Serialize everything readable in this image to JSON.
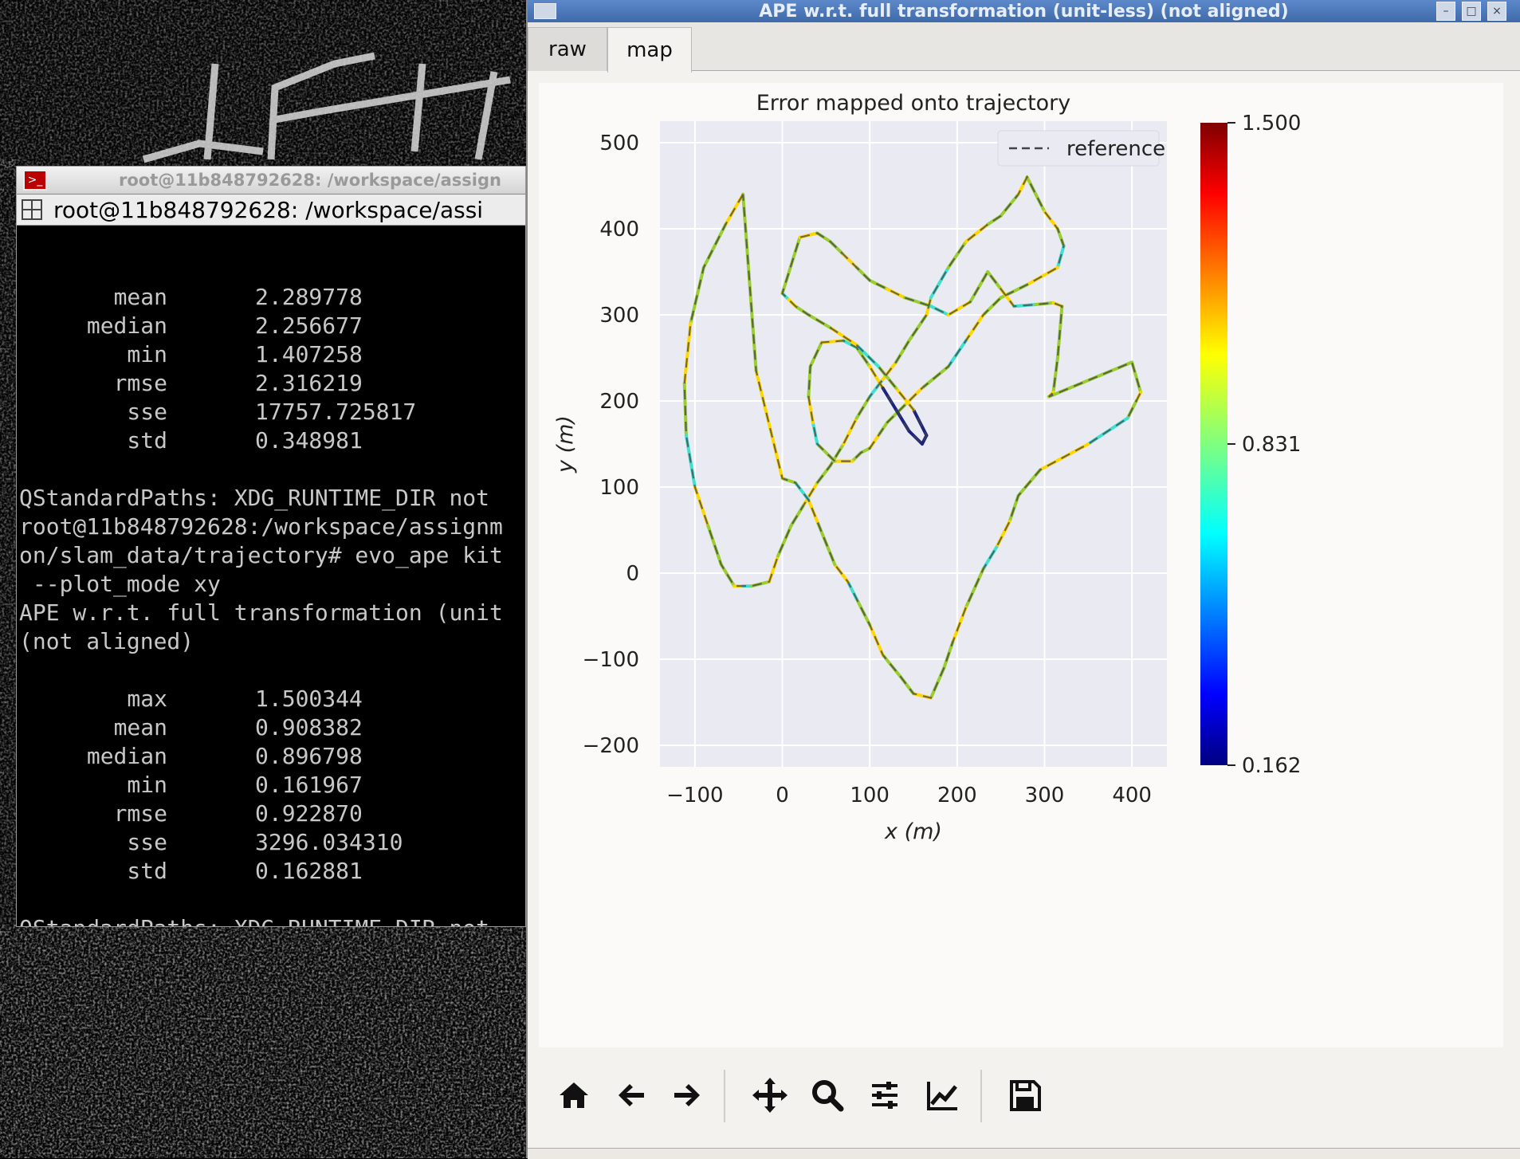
{
  "terminal": {
    "window_title": "root@11b848792628: /workspace/assign",
    "tab_title": "root@11b848792628: /workspace/assi",
    "stats1": [
      {
        "k": "mean",
        "v": "2.289778"
      },
      {
        "k": "median",
        "v": "2.256677"
      },
      {
        "k": "min",
        "v": "1.407258"
      },
      {
        "k": "rmse",
        "v": "2.316219"
      },
      {
        "k": "sse",
        "v": "17757.725817"
      },
      {
        "k": "std",
        "v": "0.348981"
      }
    ],
    "lines": [
      "QStandardPaths: XDG_RUNTIME_DIR not",
      "root@11b848792628:/workspace/assignm",
      "on/slam_data/trajectory# evo_ape kit",
      " --plot_mode xy",
      "APE w.r.t. full transformation (unit",
      "(not aligned)"
    ],
    "stats2": [
      {
        "k": "max",
        "v": "1.500344"
      },
      {
        "k": "mean",
        "v": "0.908382"
      },
      {
        "k": "median",
        "v": "0.896798"
      },
      {
        "k": "min",
        "v": "0.161967"
      },
      {
        "k": "rmse",
        "v": "0.922870"
      },
      {
        "k": "sse",
        "v": "3296.034310"
      },
      {
        "k": "std",
        "v": "0.162881"
      }
    ],
    "last_line": "QStandardPaths: XDG_RUNTIME_DIR not"
  },
  "plot_window": {
    "title": "APE w.r.t. full transformation (unit-less) (not aligned)",
    "tabs": [
      "raw",
      "map"
    ],
    "active_tab": "map",
    "toolbar_icons": [
      "home-icon",
      "back-arrow-icon",
      "forward-arrow-icon",
      "pan-icon",
      "zoom-icon",
      "configure-subplots-icon",
      "edit-axis-icon",
      "save-icon"
    ]
  },
  "chart_data": {
    "type": "line",
    "title": "Error mapped onto trajectory",
    "xlabel": "x (m)",
    "ylabel": "y (m)",
    "xlim": [
      -140,
      440
    ],
    "ylim": [
      -225,
      525
    ],
    "xticks": [
      -100,
      0,
      100,
      200,
      300,
      400
    ],
    "yticks": [
      -200,
      -100,
      0,
      100,
      200,
      300,
      400,
      500
    ],
    "xtick_labels": [
      "−100",
      "0",
      "100",
      "200",
      "300",
      "400"
    ],
    "ytick_labels": [
      "−200",
      "−100",
      "0",
      "100",
      "200",
      "300",
      "400",
      "500"
    ],
    "grid": true,
    "legend": {
      "position": "top-right",
      "entries": [
        "reference"
      ]
    },
    "colorbar": {
      "min": 0.162,
      "max": 1.5,
      "labels": [
        "1.500",
        "0.831",
        "0.162"
      ],
      "colormap": "jet"
    },
    "background": "#eaeaf2",
    "series": [
      {
        "name": "reference",
        "style": "dashed",
        "x": [
          -45,
          -65,
          -90,
          -105,
          -112,
          -110,
          -100,
          -85,
          -70,
          -55,
          -45,
          -35,
          -15,
          -5,
          10,
          25,
          40,
          55,
          70,
          85,
          100,
          115,
          130,
          145,
          165,
          170,
          190,
          210,
          235,
          250,
          270,
          280,
          290,
          300,
          315,
          322,
          315,
          280,
          250,
          230,
          210,
          190,
          160,
          140,
          120,
          110,
          100,
          90,
          80,
          60,
          40,
          35,
          30,
          32,
          45,
          70,
          85,
          100,
          115,
          130,
          145,
          160,
          165,
          150,
          130,
          110,
          85,
          55,
          30,
          15,
          5,
          0,
          20,
          40,
          55,
          70,
          85,
          100,
          120,
          140,
          170,
          190,
          215,
          235,
          250,
          265,
          290,
          310,
          320,
          315,
          310,
          305,
          400,
          410,
          405,
          395,
          350,
          295,
          270,
          260,
          245,
          230,
          210,
          195,
          185,
          170,
          150,
          135,
          115,
          100,
          85,
          75,
          60,
          50,
          40,
          30,
          15,
          0,
          -30,
          -45
        ],
        "y": [
          440,
          405,
          355,
          290,
          220,
          160,
          100,
          55,
          10,
          -15,
          -15,
          -15,
          -10,
          20,
          55,
          80,
          105,
          125,
          150,
          180,
          205,
          225,
          245,
          270,
          300,
          320,
          355,
          385,
          405,
          415,
          440,
          460,
          440,
          420,
          400,
          380,
          355,
          335,
          320,
          300,
          270,
          240,
          215,
          195,
          175,
          160,
          145,
          140,
          130,
          130,
          150,
          175,
          205,
          240,
          268,
          270,
          262,
          240,
          215,
          190,
          165,
          150,
          160,
          190,
          215,
          240,
          265,
          285,
          300,
          310,
          320,
          325,
          390,
          395,
          385,
          370,
          355,
          340,
          330,
          320,
          310,
          300,
          315,
          350,
          330,
          310,
          312,
          314,
          310,
          250,
          210,
          205,
          245,
          210,
          200,
          180,
          150,
          120,
          90,
          60,
          30,
          5,
          -40,
          -80,
          -110,
          -145,
          -140,
          -120,
          -95,
          -60,
          -30,
          -10,
          10,
          35,
          60,
          85,
          105,
          110,
          235,
          440
        ]
      }
    ]
  }
}
